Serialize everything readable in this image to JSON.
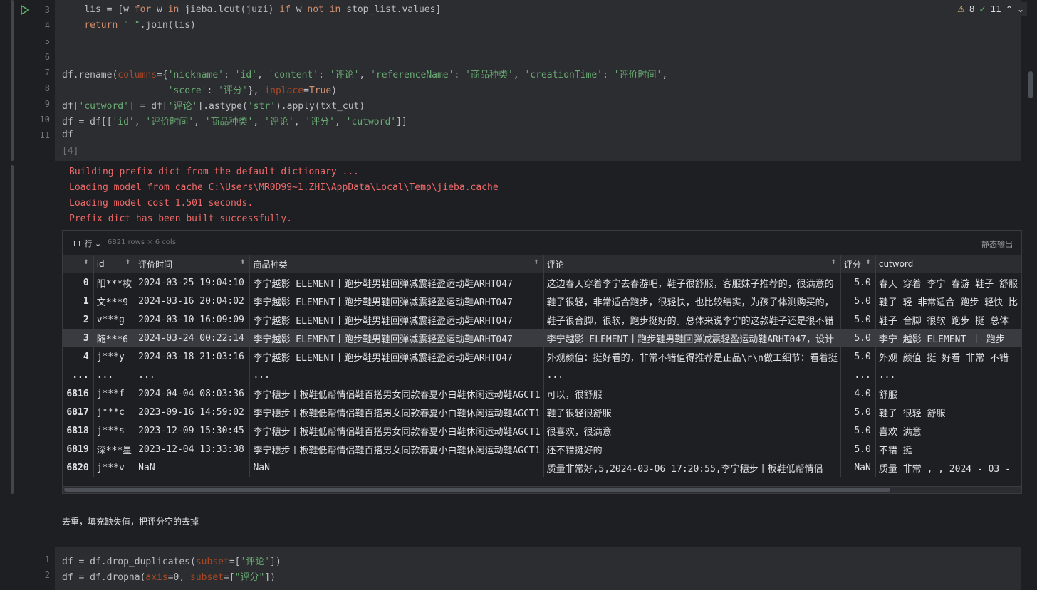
{
  "cell1": {
    "line_numbers": [
      "3",
      "4",
      "5",
      "6",
      "7",
      "8",
      "9",
      "10",
      "11"
    ],
    "exec_count": "[4]"
  },
  "inspections": {
    "warnings": "8",
    "ok": "11"
  },
  "output": {
    "lines": [
      "Building prefix dict from the default dictionary ...",
      "Loading model from cache C:\\Users\\MR0D99~1.ZHI\\AppData\\Local\\Temp\\jieba.cache",
      "Loading model cost 1.501 seconds.",
      "Prefix dict has been built successfully."
    ]
  },
  "table": {
    "rows_selector": "11 行",
    "shape_info": "6821 rows × 6 cols",
    "static_output_label": "静态输出",
    "columns": [
      "id",
      "评价时间",
      "商品种类",
      "评论",
      "评分",
      "cutword"
    ],
    "rows": [
      {
        "idx": "0",
        "id": "阳***枚",
        "time": "2024-03-25 19:04:10",
        "product": "李宁越影 ELEMENT丨跑步鞋男鞋回弹减震轻盈运动鞋ARHT047",
        "comment": "这边春天穿着李宁去春游吧，鞋子很舒服，客服妹子推荐的，很满意的",
        "score": "5.0",
        "cutword": "春天 穿着 李宁 春游 鞋子 舒服"
      },
      {
        "idx": "1",
        "id": "文***9",
        "time": "2024-03-16 20:04:02",
        "product": "李宁越影 ELEMENT丨跑步鞋男鞋回弹减震轻盈运动鞋ARHT047",
        "comment": "鞋子很轻，非常适合跑步，很轻快，也比较结实，为孩子体测购买的，",
        "score": "5.0",
        "cutword": "鞋子 轻 非常适合 跑步 轻快 比"
      },
      {
        "idx": "2",
        "id": "v***g",
        "time": "2024-03-10 16:09:09",
        "product": "李宁越影 ELEMENT丨跑步鞋男鞋回弹减震轻盈运动鞋ARHT047",
        "comment": "鞋子很合脚，很软，跑步挺好的。总体来说李宁的这款鞋子还是很不错",
        "score": "5.0",
        "cutword": "鞋子 合脚 很软 跑步 挺 总体"
      },
      {
        "idx": "3",
        "id": "随***6",
        "time": "2024-03-24 00:22:14",
        "product": "李宁越影 ELEMENT丨跑步鞋男鞋回弹减震轻盈运动鞋ARHT047",
        "comment": "李宁越影 ELEMENT丨跑步鞋男鞋回弹减震轻盈运动鞋ARHT047，设计",
        "score": "5.0",
        "cutword": "李宁 越影   ELEMENT  丨 跑步"
      },
      {
        "idx": "4",
        "id": "j***y",
        "time": "2024-03-18 21:03:16",
        "product": "李宁越影 ELEMENT丨跑步鞋男鞋回弹减震轻盈运动鞋ARHT047",
        "comment": "外观颜值：挺好看的，非常不错值得推荐是正品\\r\\n做工细节：看着挺",
        "score": "5.0",
        "cutword": "外观 颜值 挺 好看 非常 不错"
      },
      {
        "idx": "...",
        "id": "...",
        "time": "...",
        "product": "...",
        "comment": "...",
        "score": "...",
        "cutword": "..."
      },
      {
        "idx": "6816",
        "id": "j***f",
        "time": "2024-04-04 08:03:36",
        "product": "李宁穗步丨板鞋低帮情侣鞋百搭男女同款春夏小白鞋休闲运动鞋AGCT1",
        "comment": "可以，很舒服",
        "score": "4.0",
        "cutword": "舒服"
      },
      {
        "idx": "6817",
        "id": "j***c",
        "time": "2023-09-16 14:59:02",
        "product": "李宁穗步丨板鞋低帮情侣鞋百搭男女同款春夏小白鞋休闲运动鞋AGCT1",
        "comment": "鞋子很轻很舒服",
        "score": "5.0",
        "cutword": "鞋子 很轻 舒服"
      },
      {
        "idx": "6818",
        "id": "j***s",
        "time": "2023-12-09 15:30:45",
        "product": "李宁穗步丨板鞋低帮情侣鞋百搭男女同款春夏小白鞋休闲运动鞋AGCT1",
        "comment": "很喜欢，很满意",
        "score": "5.0",
        "cutword": "喜欢 满意"
      },
      {
        "idx": "6819",
        "id": "深***星",
        "time": "2023-12-04 13:33:38",
        "product": "李宁穗步丨板鞋低帮情侣鞋百搭男女同款春夏小白鞋休闲运动鞋AGCT1",
        "comment": "还不错挺好的",
        "score": "5.0",
        "cutword": "不错 挺"
      },
      {
        "idx": "6820",
        "id": "j***v",
        "time": "NaN",
        "product": "NaN",
        "comment": "质量非常好,5,2024-03-06 17:20:55,李宁穗步丨板鞋低帮情侣",
        "score": "NaN",
        "cutword": "质量 非常 , , 2024 - 03 -"
      }
    ]
  },
  "markdown": {
    "text": "去重，填充缺失值，把评分空的去掉"
  },
  "cell2": {
    "line_numbers": [
      "1",
      "2"
    ]
  }
}
